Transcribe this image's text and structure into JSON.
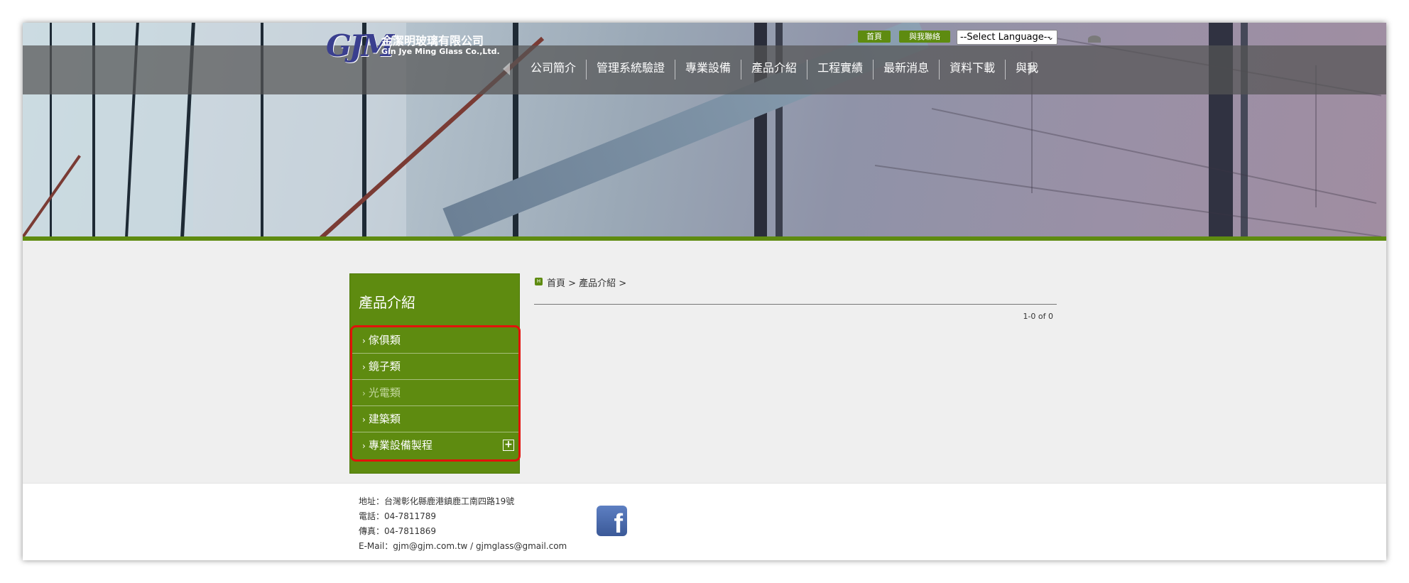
{
  "logo": {
    "mark": "GJM",
    "cn": "金潔明玻璃有限公司",
    "en": "Gin Jye Ming Glass Co.,Ltd."
  },
  "util": {
    "home_label": "首頁",
    "contact_label": "與我聯絡",
    "language_select": "--Select Language--"
  },
  "nav": {
    "items": [
      "公司簡介",
      "管理系統驗證",
      "專業設備",
      "產品介紹",
      "工程實績",
      "最新消息",
      "資料下載",
      "與我"
    ]
  },
  "sidebar": {
    "title": "產品介紹",
    "items": [
      {
        "label": "傢俱類"
      },
      {
        "label": "鏡子類"
      },
      {
        "label": "光電類"
      },
      {
        "label": "建築類"
      },
      {
        "label": "專業設備製程"
      }
    ]
  },
  "breadcrumb": {
    "icon": "H",
    "text": "首頁 > 產品介紹 >"
  },
  "pagination": {
    "count": "1-0 of 0"
  },
  "footer": {
    "address": "地址：台灣彰化縣鹿港鎮鹿工南四路19號",
    "phone": "電話：04-7811789",
    "fax": "傳真：04-7811869",
    "email": "E-Mail：gjm@gjm.com.tw / gjmglass@gmail.com",
    "social_icon": "facebook-icon"
  },
  "colors": {
    "accent_green": "#5e8b10",
    "highlight_red": "#e3120b"
  }
}
